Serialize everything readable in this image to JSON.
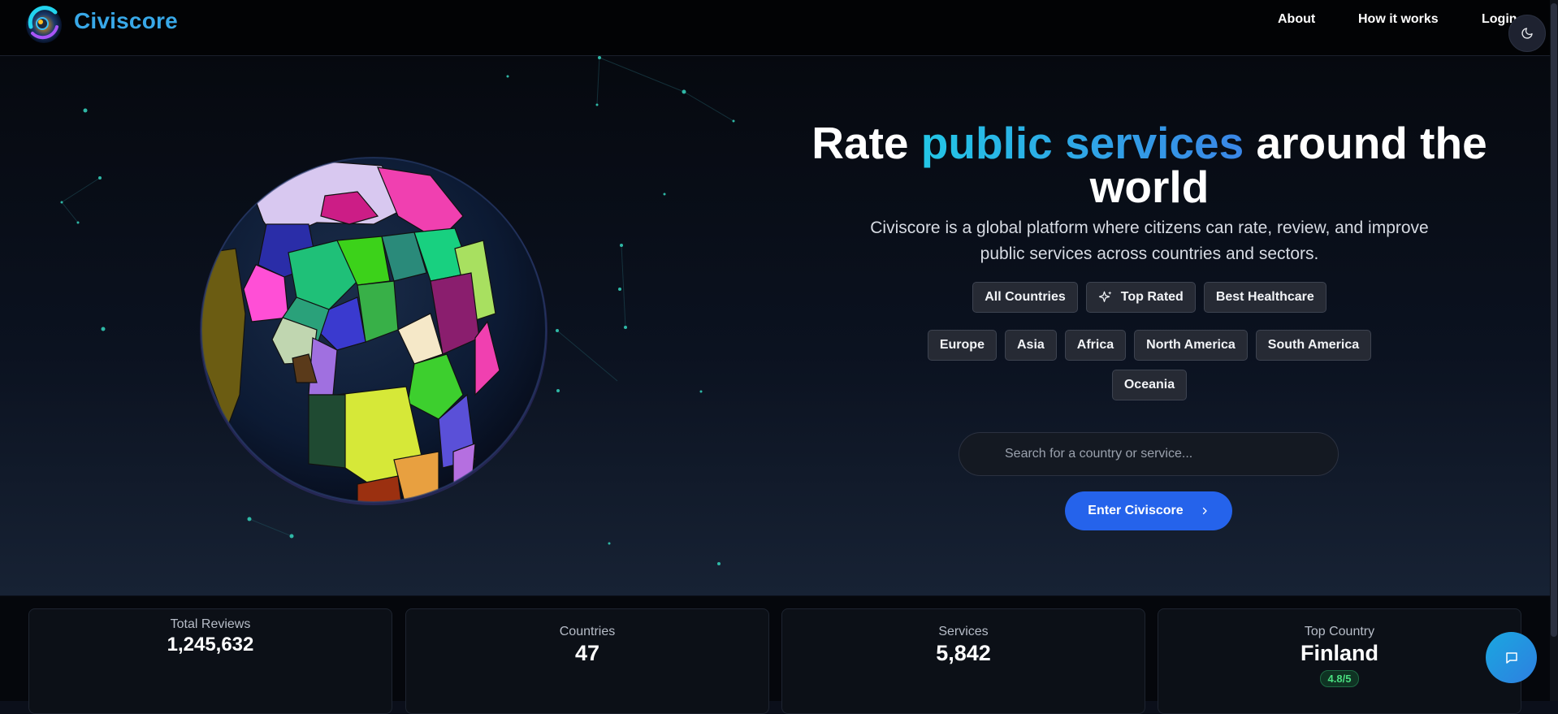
{
  "header": {
    "brand": "Civiscore",
    "nav": [
      {
        "label": "About"
      },
      {
        "label": "How it works"
      },
      {
        "label": "Login"
      }
    ],
    "theme_icon": "moon-icon"
  },
  "hero": {
    "title_part1": "Rate ",
    "title_accent": "public services",
    "title_part2": " around the world",
    "subtitle": "Civiscore is a global platform where citizens can rate, review, and improve public services across countries and sectors.",
    "filters_primary": [
      {
        "label": "All Countries"
      },
      {
        "label": "Top Rated",
        "icon": "sparkles-icon"
      },
      {
        "label": "Best Healthcare"
      }
    ],
    "regions": [
      {
        "label": "Europe"
      },
      {
        "label": "Asia"
      },
      {
        "label": "Africa"
      },
      {
        "label": "North America"
      },
      {
        "label": "South America"
      },
      {
        "label": "Oceania"
      }
    ],
    "search": {
      "placeholder": "Search for a country or service...",
      "value": ""
    },
    "cta": {
      "label": "Enter Civiscore",
      "icon": "chevron-right-icon"
    }
  },
  "stats": [
    {
      "label": "Total Reviews",
      "value": "1,245,632"
    },
    {
      "label": "Countries",
      "value": "47"
    },
    {
      "label": "Services",
      "value": "5,842"
    },
    {
      "label": "Top Country",
      "value": "Finland",
      "badge": "4.8/5"
    }
  ],
  "chat": {
    "icon": "message-icon"
  },
  "colors": {
    "accent_start": "#23c6e6",
    "accent_end": "#3a86e6",
    "cta": "#2563eb",
    "badge": "#4ade80"
  }
}
